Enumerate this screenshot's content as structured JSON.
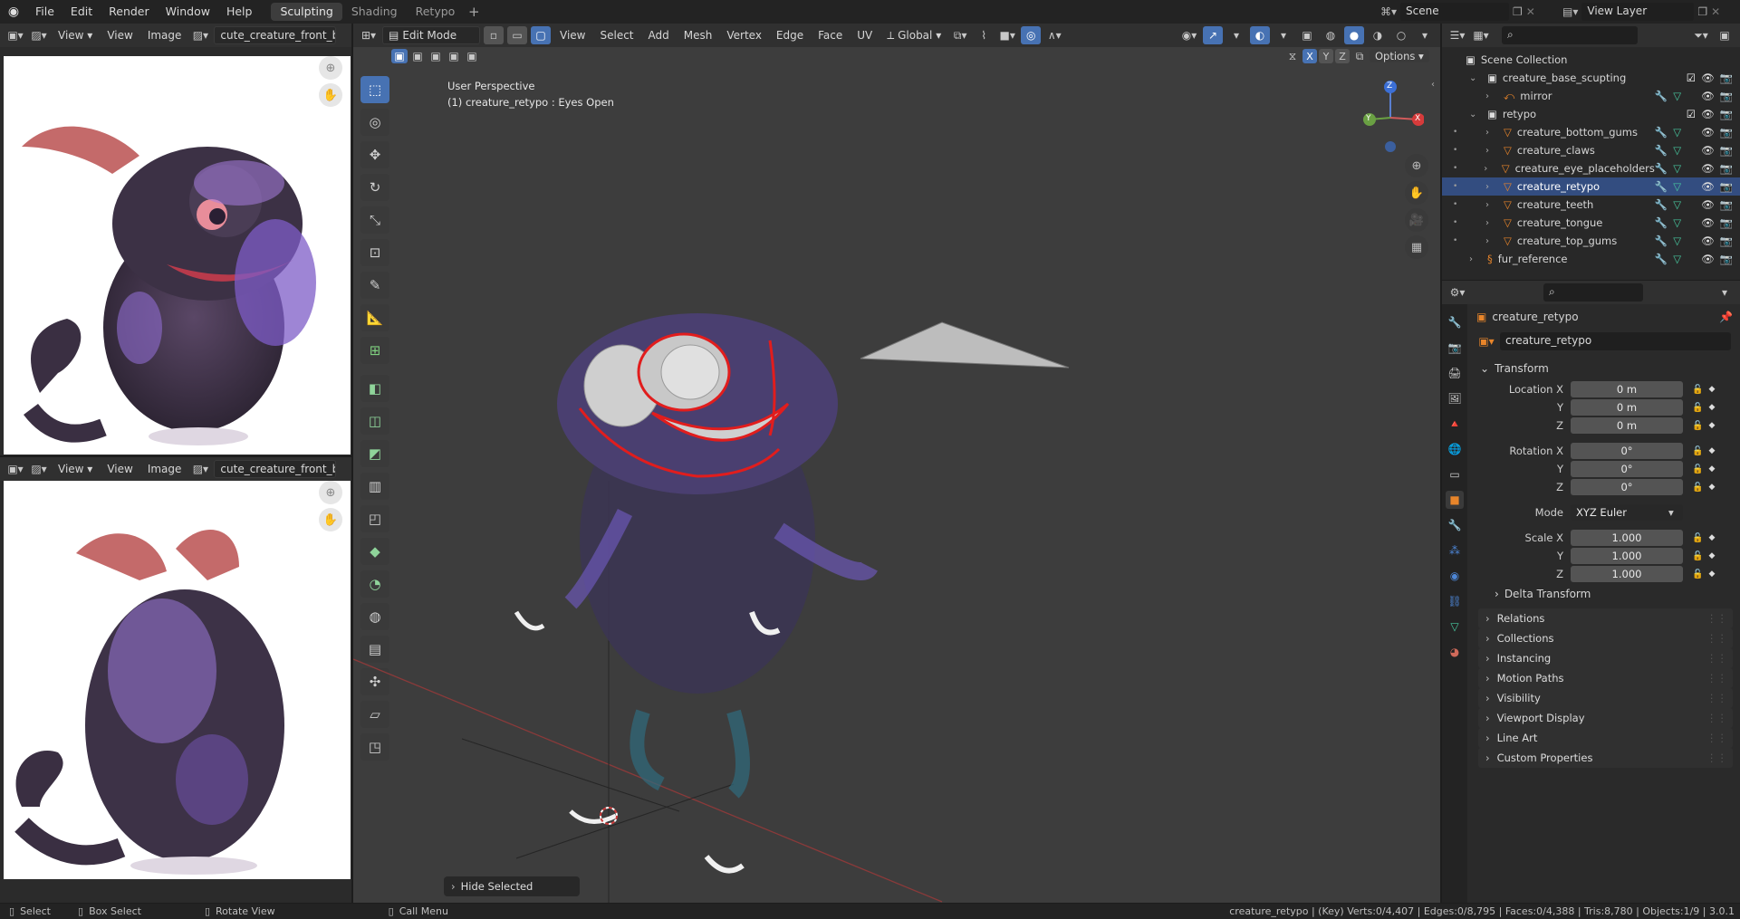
{
  "topbar": {
    "menus": [
      "File",
      "Edit",
      "Render",
      "Window",
      "Help"
    ],
    "workspace_tabs": [
      "Sculpting",
      "Shading",
      "Retypo"
    ],
    "active_tab": "Sculpting",
    "scene": "Scene",
    "view_layer": "View Layer"
  },
  "image_editor_top": {
    "menus": [
      "View",
      "View",
      "Image"
    ],
    "image_name": "cute_creature_front_back."
  },
  "image_editor_bottom": {
    "menus": [
      "View",
      "View",
      "Image"
    ],
    "image_name": "cute_creature_front_back."
  },
  "viewport": {
    "mode": "Edit Mode",
    "menus": [
      "View",
      "Select",
      "Add",
      "Mesh",
      "Vertex",
      "Edge",
      "Face",
      "UV"
    ],
    "orientation": "Global",
    "options_label": "Options",
    "axis_x": "X",
    "axis_y": "Y",
    "axis_z": "Z",
    "info_line1": "User Perspective",
    "info_line2": "(1) creature_retypo : Eyes Open",
    "last_op": "Hide Selected",
    "gizmo_z": "Z",
    "gizmo_y": "Y",
    "gizmo_x": "X"
  },
  "outliner": {
    "root": "Scene Collection",
    "items": [
      {
        "name": "creature_base_scupting",
        "level": 1
      },
      {
        "name": "mirror",
        "level": 2
      },
      {
        "name": "retypo",
        "level": 1
      },
      {
        "name": "creature_bottom_gums",
        "level": 2
      },
      {
        "name": "creature_claws",
        "level": 2
      },
      {
        "name": "creature_eye_placeholders",
        "level": 2
      },
      {
        "name": "creature_retypo",
        "level": 2,
        "selected": true
      },
      {
        "name": "creature_teeth",
        "level": 2
      },
      {
        "name": "creature_tongue",
        "level": 2
      },
      {
        "name": "creature_top_gums",
        "level": 2
      },
      {
        "name": "fur_reference",
        "level": 1
      }
    ]
  },
  "properties": {
    "object_title": "creature_retypo",
    "object_name": "creature_retypo",
    "transform_label": "Transform",
    "location_x_label": "Location X",
    "rotation_x_label": "Rotation X",
    "scale_x_label": "Scale X",
    "y_label": "Y",
    "z_label": "Z",
    "mode_label": "Mode",
    "location_x": "0 m",
    "location_y": "0 m",
    "location_z": "0 m",
    "rotation_x": "0°",
    "rotation_y": "0°",
    "rotation_z": "0°",
    "mode": "XYZ Euler",
    "scale_x": "1.000",
    "scale_y": "1.000",
    "scale_z": "1.000",
    "delta_transform": "Delta Transform",
    "sections": [
      "Relations",
      "Collections",
      "Instancing",
      "Motion Paths",
      "Visibility",
      "Viewport Display",
      "Line Art",
      "Custom Properties"
    ]
  },
  "statusbar": {
    "select": "Select",
    "box_select": "Box Select",
    "rotate_view": "Rotate View",
    "call_menu": "Call Menu",
    "stats": "creature_retypo | (Key) Verts:0/4,407 | Edges:0/8,795 | Faces:0/4,388 | Tris:8,780 | Objects:1/9 | 3.0.1"
  },
  "colors": {
    "accent": "#4772b3",
    "selection": "#334d80",
    "mesh_seam": "#e02020"
  }
}
